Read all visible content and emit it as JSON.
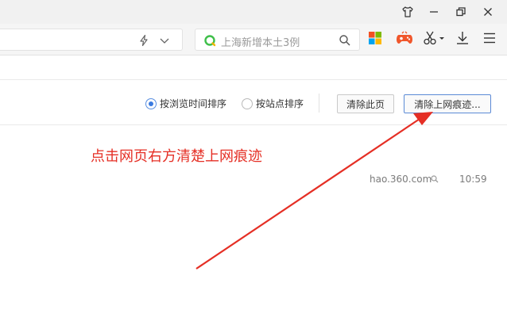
{
  "toolbar": {
    "search_suggestion": "上海新增本土3例"
  },
  "history": {
    "sort_by_time_label": "按浏览时间排序",
    "sort_by_site_label": "按站点排序",
    "sort_by_time_selected": true,
    "clear_page_label": "清除此页",
    "clear_traces_label": "清除上网痕迹..."
  },
  "entries": [
    {
      "domain": "hao.360.com",
      "time": "10:59"
    }
  ],
  "annotation": {
    "text": "点击网页右方清楚上网痕迹",
    "color": "#e52f25"
  },
  "icons": {
    "titlebar": [
      "shirt-icon",
      "minimize-icon",
      "restore-icon",
      "close-icon"
    ],
    "toolbar": [
      "lightning-icon",
      "chevron-down-icon",
      "search-icon",
      "apps-icon",
      "game-icon",
      "scissors-icon",
      "download-icon",
      "menu-icon"
    ]
  }
}
